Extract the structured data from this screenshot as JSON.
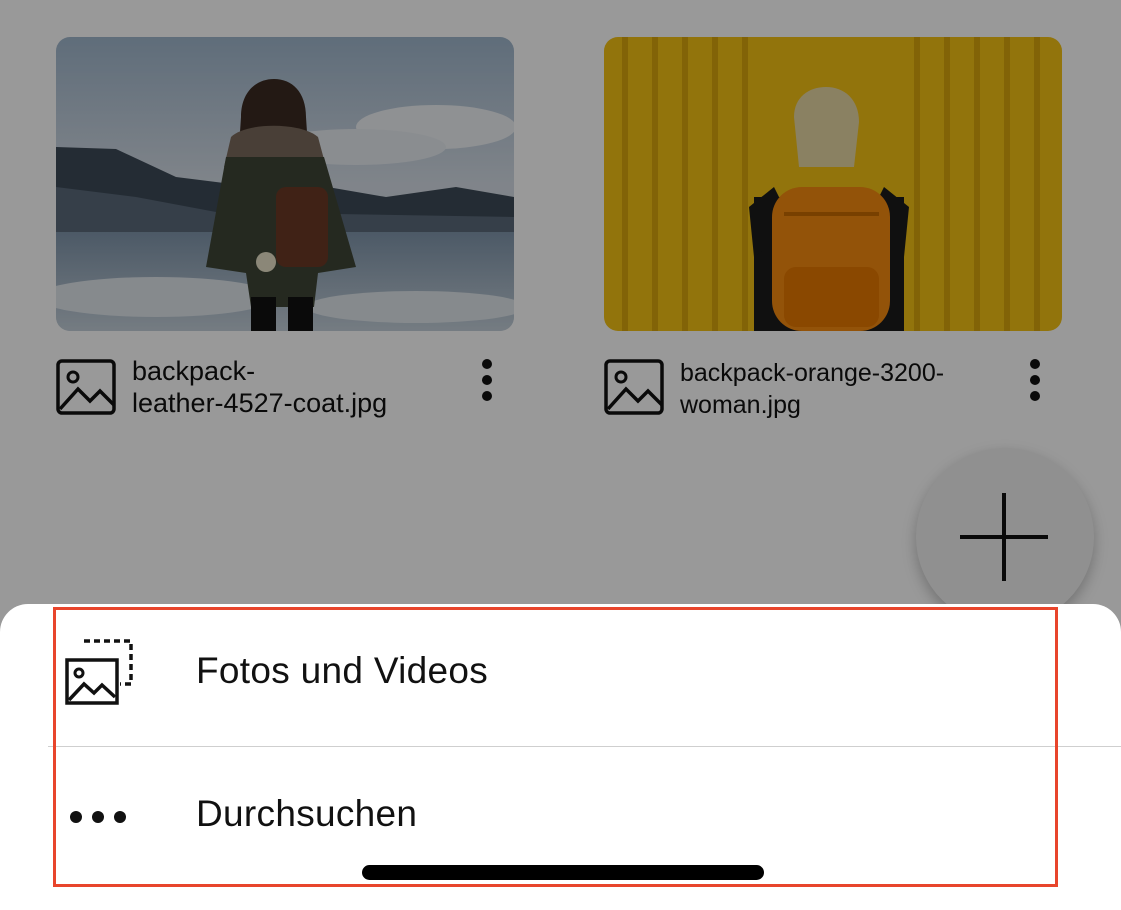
{
  "files": [
    {
      "name": "backpack-leather-4527-coat.jpg",
      "name_line1": "backpack-",
      "name_line2": "leather-4527-coat.jpg",
      "type_icon": "image-icon"
    },
    {
      "name": "backpack-orange-3200-woman.jpg",
      "name_line1": "backpack-orange-3200-",
      "name_line2": "woman.jpg",
      "type_icon": "image-icon"
    }
  ],
  "fab": {
    "icon": "plus-icon"
  },
  "sheet": {
    "items": [
      {
        "label": "Fotos und Videos",
        "icon": "photos-icon"
      },
      {
        "label": "Durchsuchen",
        "icon": "more-horizontal-icon"
      }
    ]
  },
  "colors": {
    "highlight": "#e8452c",
    "overlay": "rgba(0,0,0,0.40)"
  }
}
